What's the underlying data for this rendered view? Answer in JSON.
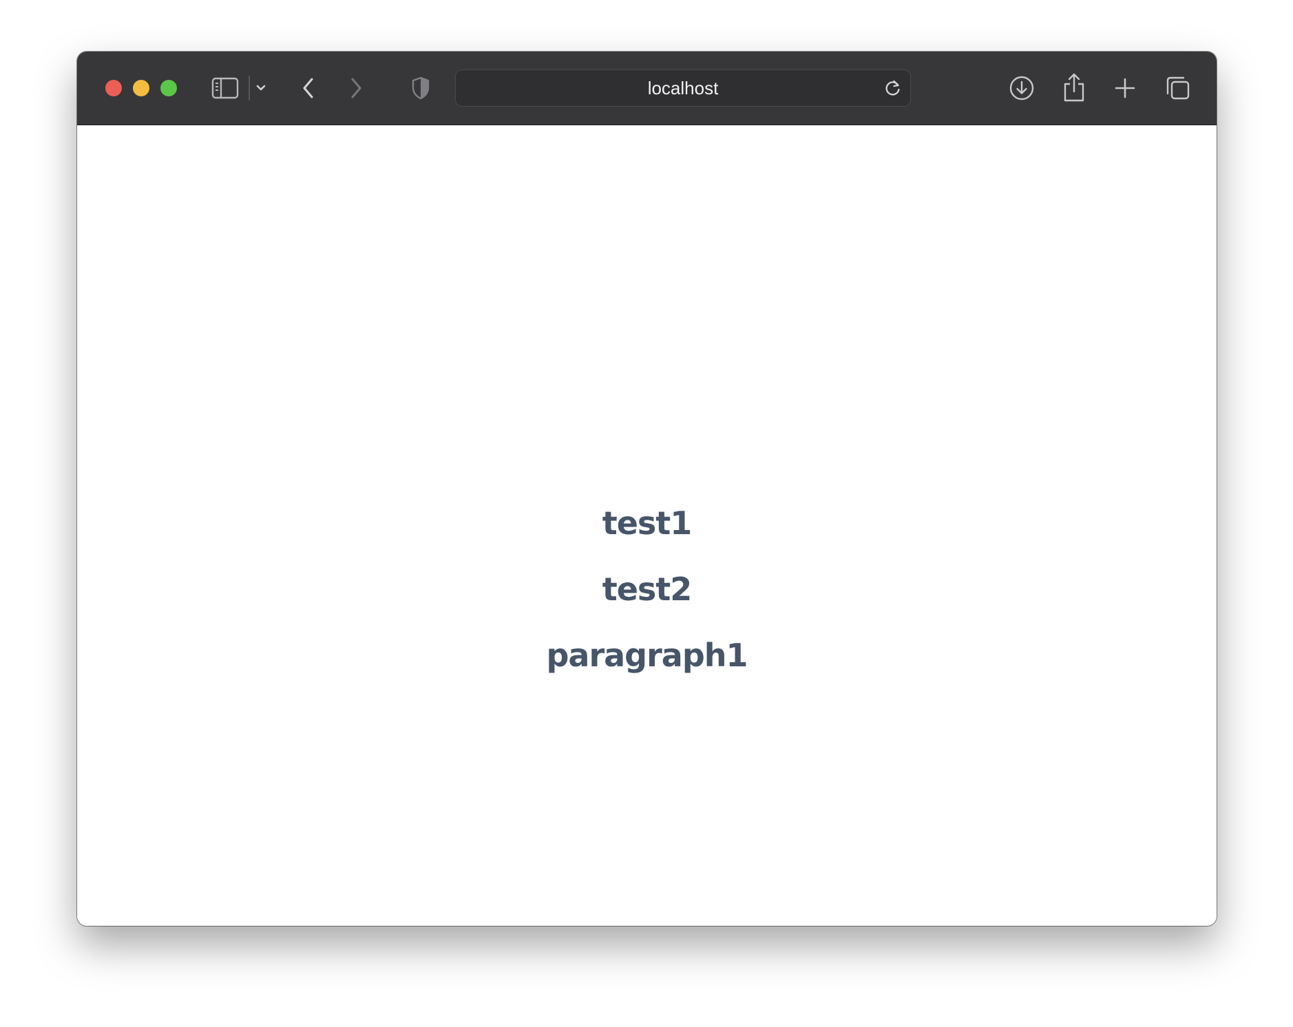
{
  "browser": {
    "address_bar": {
      "text": "localhost"
    },
    "icons": {
      "traffic_close": "close-dot",
      "traffic_minimize": "minimize-dot",
      "traffic_maximize": "maximize-dot",
      "sidebar": "sidebar-icon",
      "sidebar_menu": "chevron-down-icon",
      "back": "chevron-left-icon",
      "forward": "chevron-right-icon",
      "privacy": "shield-icon",
      "reload": "reload-icon",
      "download": "download-icon",
      "share": "share-icon",
      "new_tab": "plus-icon",
      "tabs_overview": "tabs-icon"
    },
    "colors": {
      "toolbar": "#37373a",
      "close": "#ec5f56",
      "minimize": "#f3bd40",
      "maximize": "#5cc64a"
    }
  },
  "page": {
    "lines": [
      "test1",
      "test2",
      "paragraph1"
    ],
    "text_color": "#475569"
  }
}
